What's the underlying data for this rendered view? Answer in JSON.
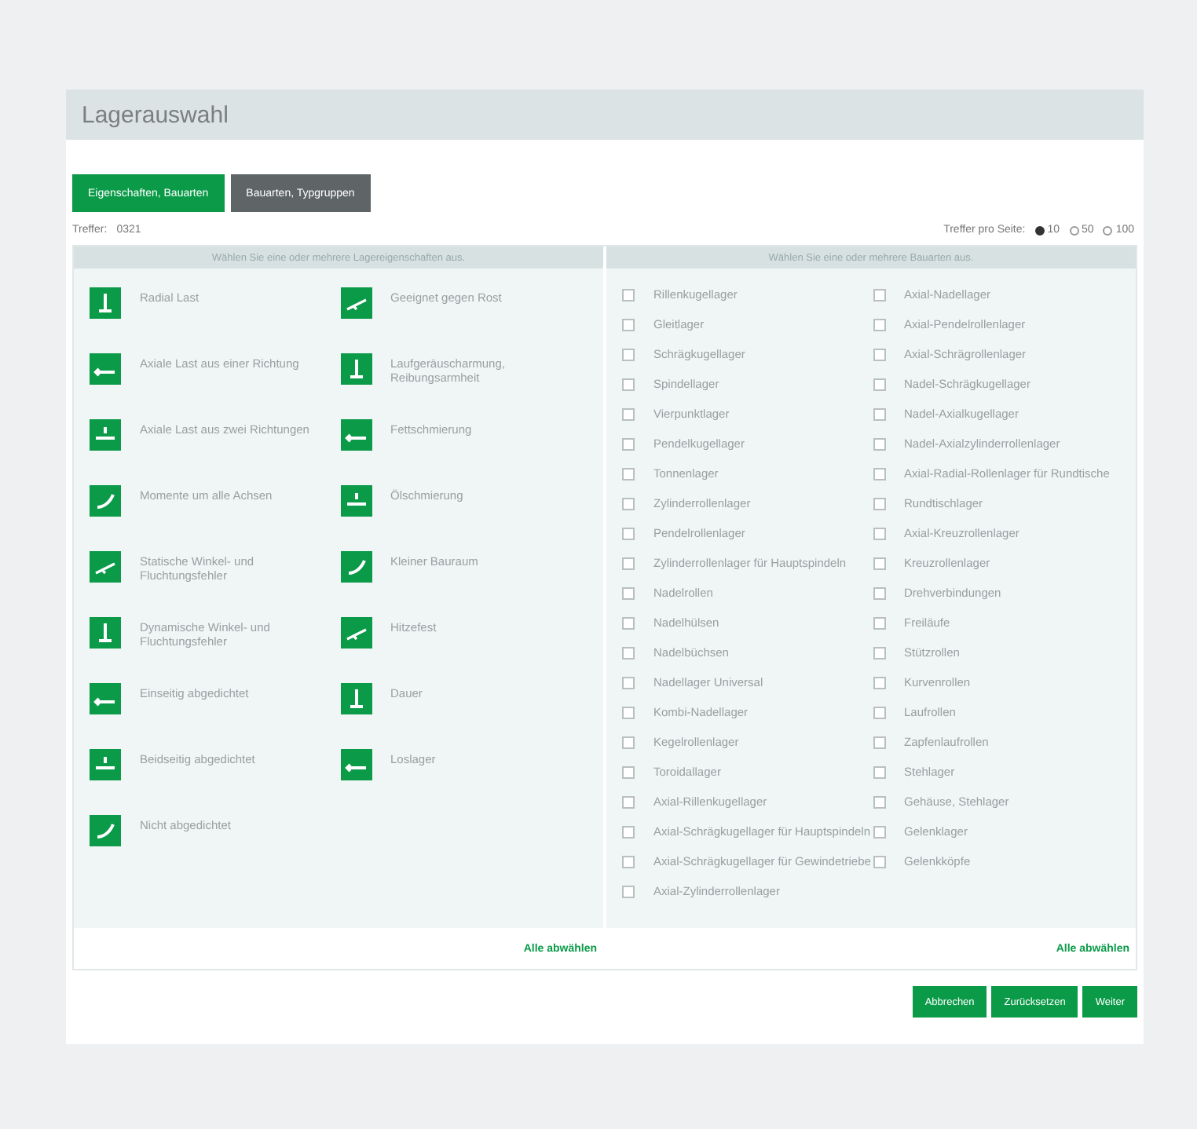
{
  "title": "Lagerauswahl",
  "tabs": [
    {
      "label": "Eigenschaften, Bauarten",
      "selected": true
    },
    {
      "label": "Bauarten, Typgruppen",
      "selected": false
    }
  ],
  "hits": {
    "label": "Treffer:",
    "value": "0321"
  },
  "per_page": {
    "label": "Treffer pro Seite:",
    "options": [
      {
        "label": "10",
        "selected": true
      },
      {
        "label": "50",
        "selected": false
      },
      {
        "label": "100",
        "selected": false
      }
    ]
  },
  "properties": {
    "header": "Wählen Sie eine oder mehrere Lagereigenschaften aus.",
    "columns": [
      [
        "Radial Last",
        "Axiale Last aus einer Richtung",
        "Axiale Last aus zwei Richtungen",
        "Momente um alle Achsen",
        "Statische Winkel- und Fluchtungsfehler",
        "Dynamische Winkel- und Fluchtungsfehler",
        "Einseitig abgedichtet",
        "Beidseitig abgedichtet",
        "Nicht abgedichtet"
      ],
      [
        "Geeignet gegen Rost",
        "Laufgeräuscharmung, Reibungsarmheit",
        "Fettschmierung",
        "Ölschmierung",
        "Kleiner Bauraum",
        "Hitzefest",
        "Dauer",
        "Loslager"
      ]
    ],
    "deselect": "Alle abwählen"
  },
  "types": {
    "header": "Wählen Sie eine oder mehrere Bauarten aus.",
    "columns": [
      [
        {
          "label": "Rillenkugellager",
          "checked": false
        },
        {
          "label": "Gleitlager",
          "checked": false
        },
        {
          "label": "Schrägkugellager",
          "checked": false
        },
        {
          "label": "Spindellager",
          "checked": false
        },
        {
          "label": "Vierpunktlager",
          "checked": false
        },
        {
          "label": "Pendelkugellager",
          "checked": false
        },
        {
          "label": "Tonnenlager",
          "checked": false
        },
        {
          "label": "Zylinderrollenlager",
          "checked": false
        },
        {
          "label": "Pendelrollenlager",
          "checked": false
        },
        {
          "label": "Zylinderrollenlager für Hauptspindeln",
          "checked": false
        },
        {
          "label": "Nadelrollen",
          "checked": false
        },
        {
          "label": "Nadelhülsen",
          "checked": false
        },
        {
          "label": "Nadelbüchsen",
          "checked": false
        },
        {
          "label": "Nadellager Universal",
          "checked": false
        },
        {
          "label": "Kombi-Nadellager",
          "checked": false
        },
        {
          "label": "Kegelrollenlager",
          "checked": false
        },
        {
          "label": "Toroidallager",
          "checked": false
        },
        {
          "label": "Axial-Rillenkugellager",
          "checked": false
        },
        {
          "label": "Axial-Schrägkugellager für Hauptspindeln",
          "checked": false
        },
        {
          "label": "Axial-Schrägkugellager für Gewindetriebe",
          "checked": false
        },
        {
          "label": "Axial-Zylinderrollenlager",
          "checked": false
        }
      ],
      [
        {
          "label": "Axial-Nadellager",
          "checked": false
        },
        {
          "label": "Axial-Pendelrollenlager",
          "checked": false
        },
        {
          "label": "Axial-Schrägrollenlager",
          "checked": false
        },
        {
          "label": "Nadel-Schrägkugellager",
          "checked": false
        },
        {
          "label": "Nadel-Axialkugellager",
          "checked": false
        },
        {
          "label": "Nadel-Axialzylinderrollenlager",
          "checked": false
        },
        {
          "label": "Axial-Radial-Rollenlager für Rundtische",
          "checked": false
        },
        {
          "label": "Rundtischlager",
          "checked": false
        },
        {
          "label": "Axial-Kreuzrollenlager",
          "checked": false
        },
        {
          "label": "Kreuzrollenlager",
          "checked": false
        },
        {
          "label": "Drehverbindungen",
          "checked": false
        },
        {
          "label": "Freiläufe",
          "checked": false
        },
        {
          "label": "Stützrollen",
          "checked": false
        },
        {
          "label": "Kurvenrollen",
          "checked": false
        },
        {
          "label": "Laufrollen",
          "checked": false
        },
        {
          "label": "Zapfenlaufrollen",
          "checked": false
        },
        {
          "label": "Stehlager",
          "checked": false
        },
        {
          "label": "Gehäuse, Stehlager",
          "checked": false
        },
        {
          "label": "Gelenklager",
          "checked": false
        },
        {
          "label": "Gelenkköpfe",
          "checked": false
        }
      ]
    ],
    "deselect": "Alle abwählen"
  },
  "buttons": [
    "Abbrechen",
    "Zurücksetzen",
    "Weiter"
  ]
}
